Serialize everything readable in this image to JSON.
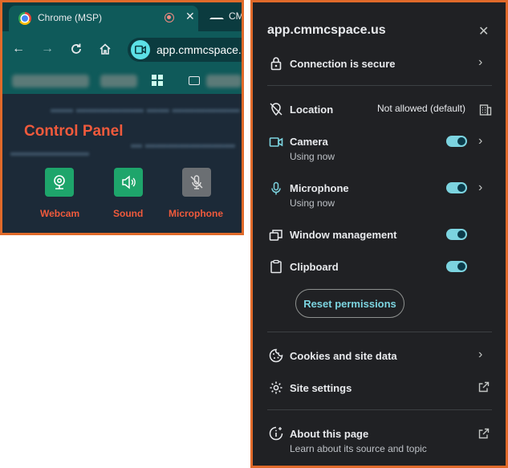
{
  "browser": {
    "tab_title": "Chrome (MSP)",
    "tab_close": "✕",
    "tab2_title": "CM",
    "address": "app.cmmcspace.us",
    "page": {
      "title": "Control Panel",
      "buttons": [
        {
          "label": "Webcam",
          "color": "#1ea56b"
        },
        {
          "label": "Sound",
          "color": "#1ea56b"
        },
        {
          "label": "Microphone",
          "color": "#6b6f73"
        }
      ]
    }
  },
  "panel": {
    "host": "app.cmmcspace.us",
    "close": "✕",
    "connection": {
      "label": "Connection is secure"
    },
    "location": {
      "label": "Location",
      "value": "Not allowed (default)"
    },
    "camera": {
      "label": "Camera",
      "sub": "Using now",
      "enabled": true
    },
    "microphone": {
      "label": "Microphone",
      "sub": "Using now",
      "enabled": true
    },
    "window_management": {
      "label": "Window management",
      "enabled": true
    },
    "clipboard": {
      "label": "Clipboard",
      "enabled": true
    },
    "reset_button": "Reset permissions",
    "cookies": {
      "label": "Cookies and site data"
    },
    "site_settings": {
      "label": "Site settings"
    },
    "about": {
      "label": "About this page",
      "sub": "Learn about its source and topic"
    },
    "accent_color": "#7cd4e0",
    "frame_color": "#e06a2a"
  }
}
